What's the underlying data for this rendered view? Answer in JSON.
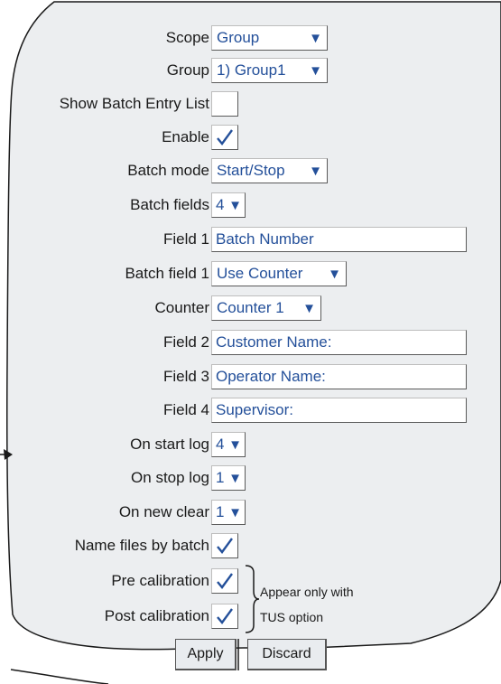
{
  "form": {
    "scope": {
      "label": "Scope",
      "value": "Group"
    },
    "group": {
      "label": "Group",
      "value": "1) Group1"
    },
    "show_batch_entry_list": {
      "label": "Show Batch Entry List",
      "checked": false
    },
    "enable": {
      "label": "Enable",
      "checked": true
    },
    "batch_mode": {
      "label": "Batch mode",
      "value": "Start/Stop"
    },
    "batch_fields": {
      "label": "Batch fields",
      "value": "4"
    },
    "field1": {
      "label": "Field 1",
      "value": "Batch Number"
    },
    "batch_field1": {
      "label": "Batch field 1",
      "value": "Use Counter"
    },
    "counter": {
      "label": "Counter",
      "value": "Counter 1"
    },
    "field2": {
      "label": "Field 2",
      "value": "Customer Name:"
    },
    "field3": {
      "label": "Field 3",
      "value": "Operator Name:"
    },
    "field4": {
      "label": "Field 4",
      "value": "Supervisor:"
    },
    "on_start_log": {
      "label": "On start log",
      "value": "4"
    },
    "on_stop_log": {
      "label": "On stop log",
      "value": "1"
    },
    "on_new_clear": {
      "label": "On new clear",
      "value": "1"
    },
    "name_files_by_batch": {
      "label": "Name files by batch",
      "checked": true
    },
    "pre_calibration": {
      "label": "Pre calibration",
      "checked": true
    },
    "post_calibration": {
      "label": "Post calibration",
      "checked": true
    }
  },
  "annotation": {
    "line1": "Appear only with",
    "line2": "TUS option"
  },
  "buttons": {
    "apply": "Apply",
    "discard": "Discard"
  },
  "colors": {
    "value_text": "#24509a",
    "panel": "#eceef0",
    "outline": "#1a1a1a"
  }
}
